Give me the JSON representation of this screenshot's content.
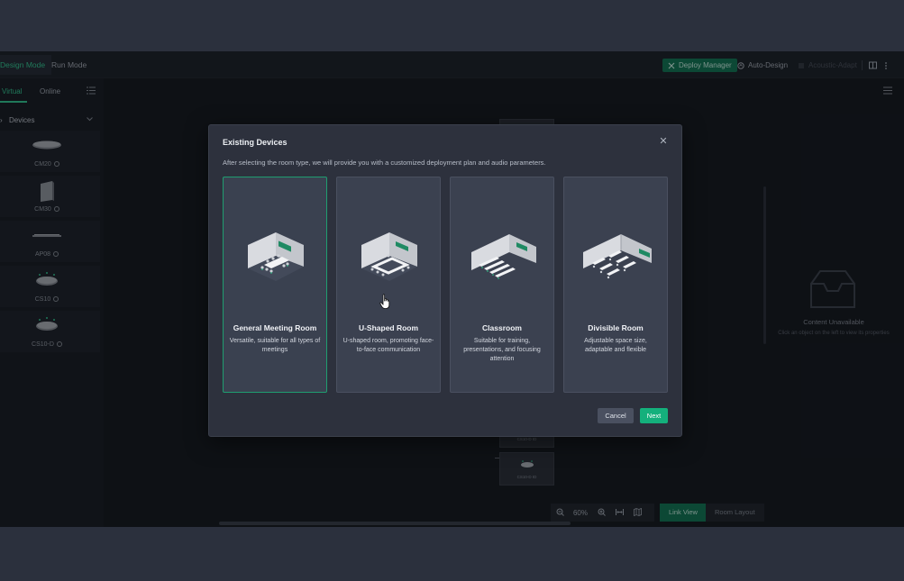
{
  "topbar": {
    "tabs": [
      {
        "label": "Design Mode",
        "active": true
      },
      {
        "label": "Run Mode",
        "active": false
      }
    ],
    "deploy_manager": "Deploy Manager",
    "auto_design": "Auto-Design",
    "acoustic_adapt": "Acoustic-Adapt"
  },
  "left_panel": {
    "tabs": [
      {
        "label": "Virtual",
        "active": true
      },
      {
        "label": "Online",
        "active": false
      }
    ],
    "section": "Devices",
    "devices": [
      {
        "name": "CM20",
        "icon": "ceiling-disc-icon"
      },
      {
        "name": "CM30",
        "icon": "wall-panel-icon"
      },
      {
        "name": "AP08",
        "icon": "bar-array-icon"
      },
      {
        "name": "CS10",
        "icon": "table-mic-icon"
      },
      {
        "name": "CS10-D",
        "icon": "table-mic-icon"
      }
    ]
  },
  "right_panel": {
    "title": "Content Unavailable",
    "subtitle": "Click an object on the left to view its properties"
  },
  "canvas": {
    "node_labels": [
      "CS10-D ID",
      "CS10-D ID"
    ],
    "zoom": "60%"
  },
  "view_buttons": {
    "link_view": "Link View",
    "room_layout": "Room Layout"
  },
  "modal": {
    "title": "Existing Devices",
    "description": "After selecting the room type, we will provide you with a customized deployment plan and audio parameters.",
    "rooms": [
      {
        "name": "General Meeting Room",
        "desc": "Versatile, suitable for all types of meetings",
        "selected": true
      },
      {
        "name": "U-Shaped Room",
        "desc": "U-shaped room, promoting face-to-face communication",
        "selected": false
      },
      {
        "name": "Classroom",
        "desc": "Suitable for training, presentations, and focusing attention",
        "selected": false
      },
      {
        "name": "Divisible Room",
        "desc": "Adjustable space size, adaptable and flexible",
        "selected": false
      }
    ],
    "cancel": "Cancel",
    "next": "Next"
  },
  "colors": {
    "accent": "#14b07c",
    "accent_dark": "#0f7a57",
    "modal_bg": "#2d313d",
    "card_bg": "#3b4150"
  }
}
